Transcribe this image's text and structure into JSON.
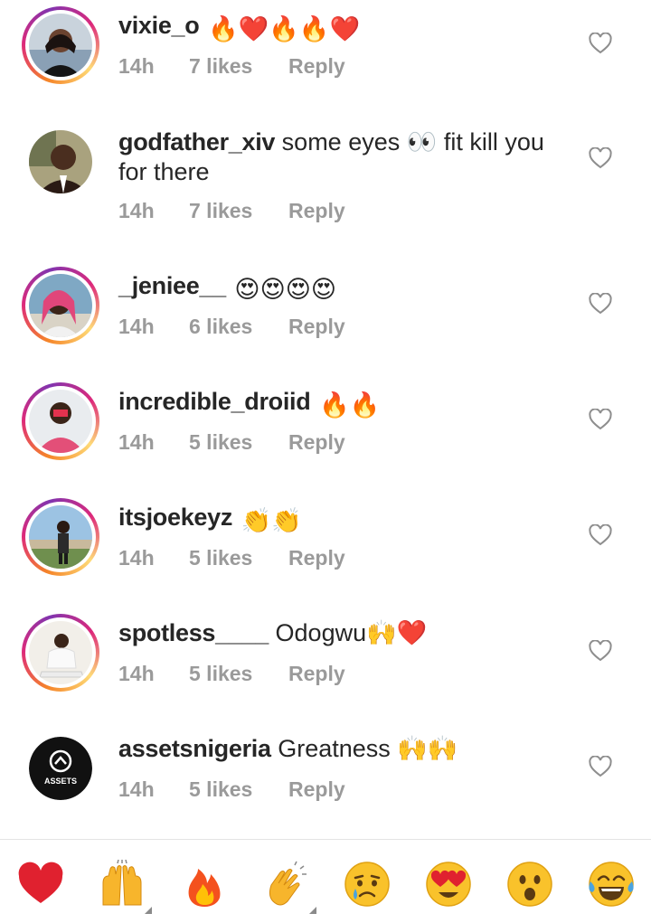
{
  "comments": [
    {
      "username": "vixie_o",
      "text": "",
      "time": "14h",
      "likes": "7 likes",
      "reply": "Reply",
      "emojis": "🔥❤️🔥🔥❤️"
    },
    {
      "username": "godfather_xiv",
      "text": "some eyes 👀 fit kill you for there",
      "time": "14h",
      "likes": "7 likes",
      "reply": "Reply",
      "emojis": ""
    },
    {
      "username": "_jeniee__",
      "text": "",
      "time": "14h",
      "likes": "6 likes",
      "reply": "Reply",
      "emojis": "😍😍😍😍"
    },
    {
      "username": "incredible_droiid",
      "text": "",
      "time": "14h",
      "likes": "5 likes",
      "reply": "Reply",
      "emojis": "🔥🔥"
    },
    {
      "username": "itsjoekeyz",
      "text": "",
      "time": "14h",
      "likes": "5 likes",
      "reply": "Reply",
      "emojis": "👏👏"
    },
    {
      "username": "spotless____",
      "text": "Odogwu🙌❤️",
      "time": "14h",
      "likes": "5 likes",
      "reply": "Reply",
      "emojis": ""
    },
    {
      "username": "assetsnigeria",
      "text": "Greatness 🙌🙌",
      "time": "14h",
      "likes": "5 likes",
      "reply": "Reply",
      "emojis": ""
    }
  ],
  "assets_logo_text": "ASSETS",
  "reactions": [
    "red-heart",
    "raising-hands",
    "fire",
    "clapping-hands",
    "crying-face",
    "heart-eyes",
    "astonished-face",
    "tears-of-joy"
  ],
  "colors": {
    "username": "#262626",
    "meta": "#9a9a9a",
    "heart": "#ed4956",
    "ring_start": "#f58529",
    "ring_end": "#dd2a7b"
  }
}
